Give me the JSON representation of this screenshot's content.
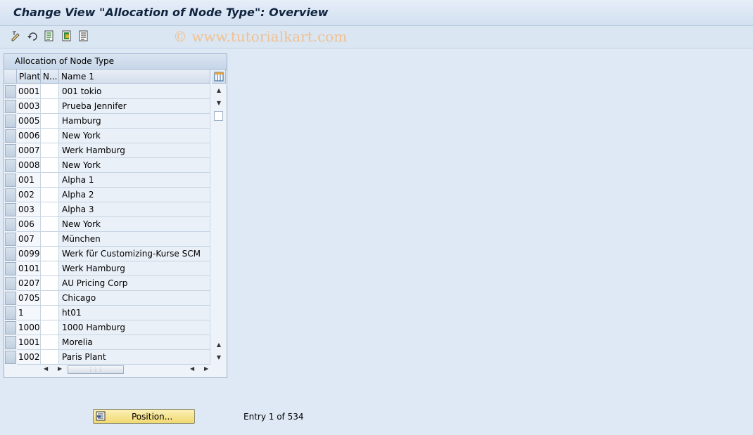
{
  "title": "Change View \"Allocation of Node Type\": Overview",
  "watermark": "© www.tutorialkart.com",
  "toolbar": {
    "icons": [
      "display-change-icon",
      "undo-icon",
      "details-icon",
      "select-all-icon",
      "deselect-icon"
    ]
  },
  "table": {
    "title": "Allocation of Node Type",
    "columns": [
      "Plant",
      "N...",
      "Name 1"
    ],
    "rows": [
      {
        "plant": "0001",
        "n": "",
        "name": "001 tokio"
      },
      {
        "plant": "0003",
        "n": "",
        "name": "Prueba Jennifer"
      },
      {
        "plant": "0005",
        "n": "",
        "name": "Hamburg"
      },
      {
        "plant": "0006",
        "n": "",
        "name": "New York"
      },
      {
        "plant": "0007",
        "n": "",
        "name": "Werk Hamburg"
      },
      {
        "plant": "0008",
        "n": "",
        "name": "New York"
      },
      {
        "plant": "001",
        "n": "",
        "name": "Alpha 1"
      },
      {
        "plant": "002",
        "n": "",
        "name": "Alpha 2"
      },
      {
        "plant": "003",
        "n": "",
        "name": "Alpha 3"
      },
      {
        "plant": "006",
        "n": "",
        "name": "New York"
      },
      {
        "plant": "007",
        "n": "",
        "name": "München"
      },
      {
        "plant": "0099",
        "n": "",
        "name": "Werk für Customizing-Kurse SCM"
      },
      {
        "plant": "0101",
        "n": "",
        "name": "Werk Hamburg"
      },
      {
        "plant": "0207",
        "n": "",
        "name": "AU Pricing Corp"
      },
      {
        "plant": "0705",
        "n": "",
        "name": "Chicago"
      },
      {
        "plant": "1",
        "n": "",
        "name": "ht01"
      },
      {
        "plant": "1000",
        "n": "",
        "name": "1000 Hamburg"
      },
      {
        "plant": "1001",
        "n": "",
        "name": "Morelia"
      },
      {
        "plant": "1002",
        "n": "",
        "name": "Paris Plant"
      }
    ]
  },
  "position_button": "Position...",
  "entry_text": "Entry 1 of 534",
  "colors": {
    "background": "#dfe9f5",
    "title_text": "#10243f",
    "button": "#f1d971"
  }
}
